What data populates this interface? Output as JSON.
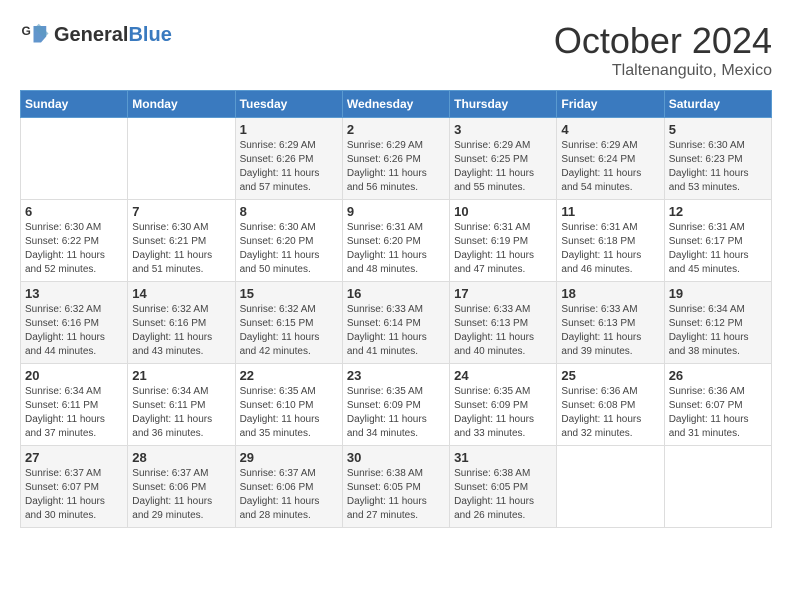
{
  "logo": {
    "text_general": "General",
    "text_blue": "Blue"
  },
  "header": {
    "month": "October 2024",
    "location": "Tlaltenanguito, Mexico"
  },
  "weekdays": [
    "Sunday",
    "Monday",
    "Tuesday",
    "Wednesday",
    "Thursday",
    "Friday",
    "Saturday"
  ],
  "weeks": [
    [
      {
        "day": "",
        "info": ""
      },
      {
        "day": "",
        "info": ""
      },
      {
        "day": "1",
        "sunrise": "Sunrise: 6:29 AM",
        "sunset": "Sunset: 6:26 PM",
        "daylight": "Daylight: 11 hours and 57 minutes."
      },
      {
        "day": "2",
        "sunrise": "Sunrise: 6:29 AM",
        "sunset": "Sunset: 6:26 PM",
        "daylight": "Daylight: 11 hours and 56 minutes."
      },
      {
        "day": "3",
        "sunrise": "Sunrise: 6:29 AM",
        "sunset": "Sunset: 6:25 PM",
        "daylight": "Daylight: 11 hours and 55 minutes."
      },
      {
        "day": "4",
        "sunrise": "Sunrise: 6:29 AM",
        "sunset": "Sunset: 6:24 PM",
        "daylight": "Daylight: 11 hours and 54 minutes."
      },
      {
        "day": "5",
        "sunrise": "Sunrise: 6:30 AM",
        "sunset": "Sunset: 6:23 PM",
        "daylight": "Daylight: 11 hours and 53 minutes."
      }
    ],
    [
      {
        "day": "6",
        "sunrise": "Sunrise: 6:30 AM",
        "sunset": "Sunset: 6:22 PM",
        "daylight": "Daylight: 11 hours and 52 minutes."
      },
      {
        "day": "7",
        "sunrise": "Sunrise: 6:30 AM",
        "sunset": "Sunset: 6:21 PM",
        "daylight": "Daylight: 11 hours and 51 minutes."
      },
      {
        "day": "8",
        "sunrise": "Sunrise: 6:30 AM",
        "sunset": "Sunset: 6:20 PM",
        "daylight": "Daylight: 11 hours and 50 minutes."
      },
      {
        "day": "9",
        "sunrise": "Sunrise: 6:31 AM",
        "sunset": "Sunset: 6:20 PM",
        "daylight": "Daylight: 11 hours and 48 minutes."
      },
      {
        "day": "10",
        "sunrise": "Sunrise: 6:31 AM",
        "sunset": "Sunset: 6:19 PM",
        "daylight": "Daylight: 11 hours and 47 minutes."
      },
      {
        "day": "11",
        "sunrise": "Sunrise: 6:31 AM",
        "sunset": "Sunset: 6:18 PM",
        "daylight": "Daylight: 11 hours and 46 minutes."
      },
      {
        "day": "12",
        "sunrise": "Sunrise: 6:31 AM",
        "sunset": "Sunset: 6:17 PM",
        "daylight": "Daylight: 11 hours and 45 minutes."
      }
    ],
    [
      {
        "day": "13",
        "sunrise": "Sunrise: 6:32 AM",
        "sunset": "Sunset: 6:16 PM",
        "daylight": "Daylight: 11 hours and 44 minutes."
      },
      {
        "day": "14",
        "sunrise": "Sunrise: 6:32 AM",
        "sunset": "Sunset: 6:16 PM",
        "daylight": "Daylight: 11 hours and 43 minutes."
      },
      {
        "day": "15",
        "sunrise": "Sunrise: 6:32 AM",
        "sunset": "Sunset: 6:15 PM",
        "daylight": "Daylight: 11 hours and 42 minutes."
      },
      {
        "day": "16",
        "sunrise": "Sunrise: 6:33 AM",
        "sunset": "Sunset: 6:14 PM",
        "daylight": "Daylight: 11 hours and 41 minutes."
      },
      {
        "day": "17",
        "sunrise": "Sunrise: 6:33 AM",
        "sunset": "Sunset: 6:13 PM",
        "daylight": "Daylight: 11 hours and 40 minutes."
      },
      {
        "day": "18",
        "sunrise": "Sunrise: 6:33 AM",
        "sunset": "Sunset: 6:13 PM",
        "daylight": "Daylight: 11 hours and 39 minutes."
      },
      {
        "day": "19",
        "sunrise": "Sunrise: 6:34 AM",
        "sunset": "Sunset: 6:12 PM",
        "daylight": "Daylight: 11 hours and 38 minutes."
      }
    ],
    [
      {
        "day": "20",
        "sunrise": "Sunrise: 6:34 AM",
        "sunset": "Sunset: 6:11 PM",
        "daylight": "Daylight: 11 hours and 37 minutes."
      },
      {
        "day": "21",
        "sunrise": "Sunrise: 6:34 AM",
        "sunset": "Sunset: 6:11 PM",
        "daylight": "Daylight: 11 hours and 36 minutes."
      },
      {
        "day": "22",
        "sunrise": "Sunrise: 6:35 AM",
        "sunset": "Sunset: 6:10 PM",
        "daylight": "Daylight: 11 hours and 35 minutes."
      },
      {
        "day": "23",
        "sunrise": "Sunrise: 6:35 AM",
        "sunset": "Sunset: 6:09 PM",
        "daylight": "Daylight: 11 hours and 34 minutes."
      },
      {
        "day": "24",
        "sunrise": "Sunrise: 6:35 AM",
        "sunset": "Sunset: 6:09 PM",
        "daylight": "Daylight: 11 hours and 33 minutes."
      },
      {
        "day": "25",
        "sunrise": "Sunrise: 6:36 AM",
        "sunset": "Sunset: 6:08 PM",
        "daylight": "Daylight: 11 hours and 32 minutes."
      },
      {
        "day": "26",
        "sunrise": "Sunrise: 6:36 AM",
        "sunset": "Sunset: 6:07 PM",
        "daylight": "Daylight: 11 hours and 31 minutes."
      }
    ],
    [
      {
        "day": "27",
        "sunrise": "Sunrise: 6:37 AM",
        "sunset": "Sunset: 6:07 PM",
        "daylight": "Daylight: 11 hours and 30 minutes."
      },
      {
        "day": "28",
        "sunrise": "Sunrise: 6:37 AM",
        "sunset": "Sunset: 6:06 PM",
        "daylight": "Daylight: 11 hours and 29 minutes."
      },
      {
        "day": "29",
        "sunrise": "Sunrise: 6:37 AM",
        "sunset": "Sunset: 6:06 PM",
        "daylight": "Daylight: 11 hours and 28 minutes."
      },
      {
        "day": "30",
        "sunrise": "Sunrise: 6:38 AM",
        "sunset": "Sunset: 6:05 PM",
        "daylight": "Daylight: 11 hours and 27 minutes."
      },
      {
        "day": "31",
        "sunrise": "Sunrise: 6:38 AM",
        "sunset": "Sunset: 6:05 PM",
        "daylight": "Daylight: 11 hours and 26 minutes."
      },
      {
        "day": "",
        "info": ""
      },
      {
        "day": "",
        "info": ""
      }
    ]
  ]
}
